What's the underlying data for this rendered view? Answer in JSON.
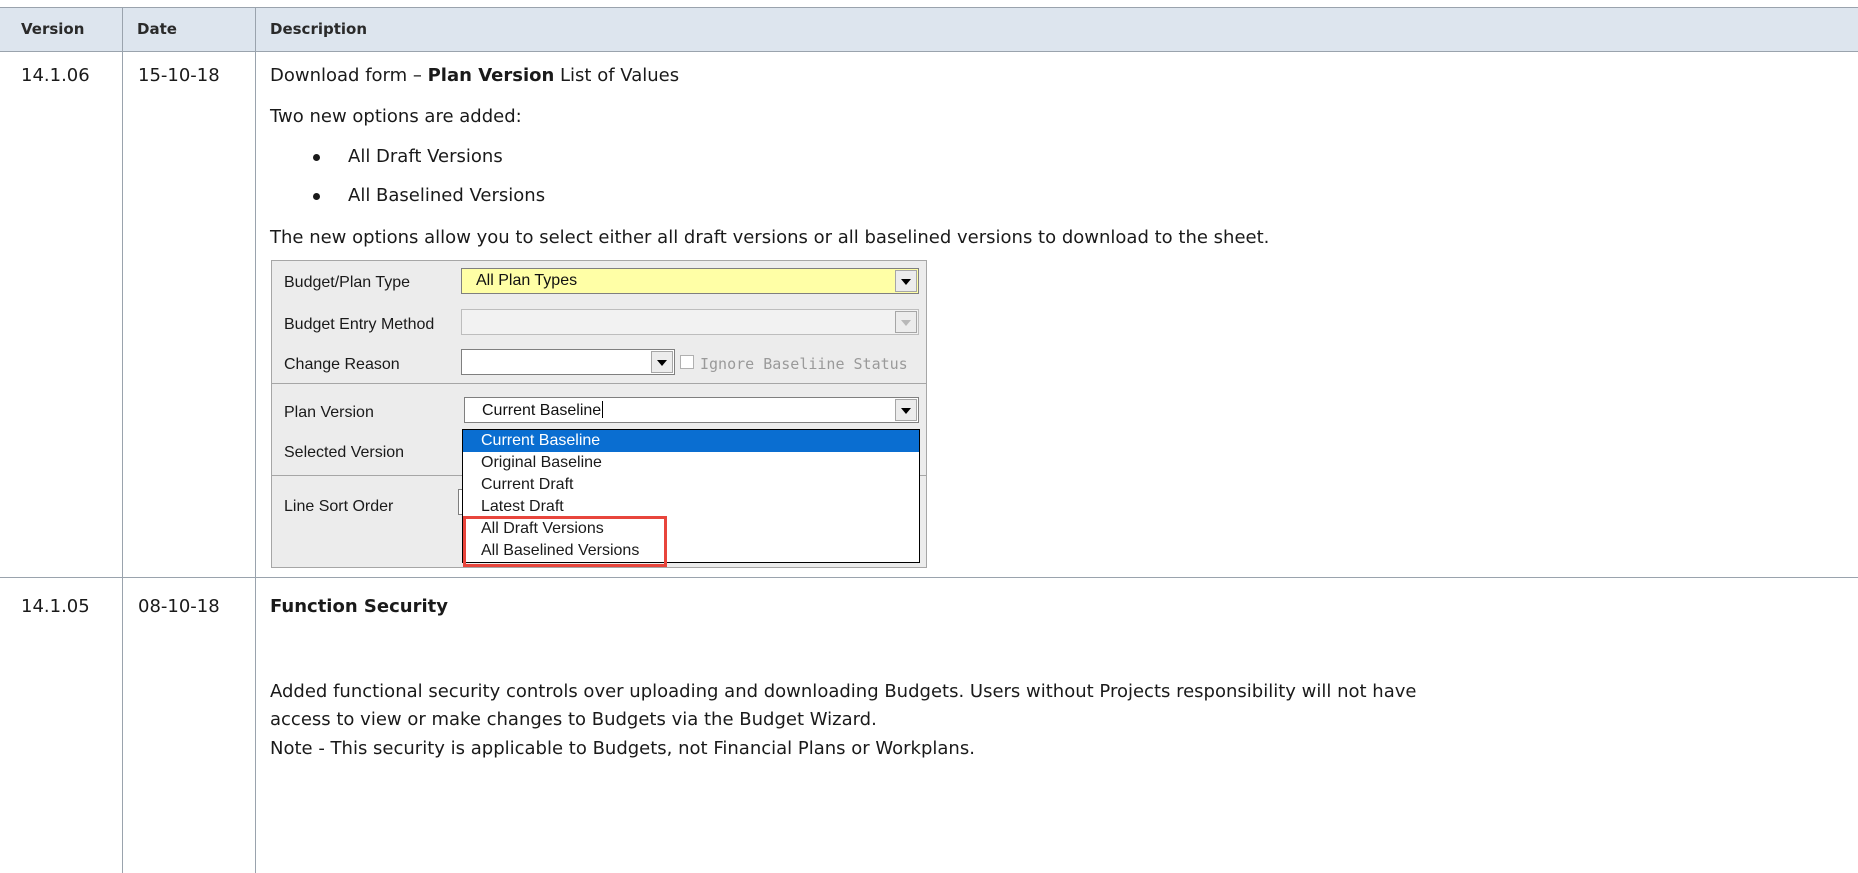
{
  "header": {
    "version": "Version",
    "date": "Date",
    "description": "Description"
  },
  "rows": [
    {
      "version": "14.1.06",
      "date": "15-10-18",
      "line1_prefix": "Download form – ",
      "line1_bold": "Plan Version",
      "line1_suffix": " List of Values",
      "line2": "Two new options are added:",
      "bullets": [
        "All Draft Versions",
        "All Baselined Versions"
      ],
      "line3": "The new options allow you to select either all draft versions or all baselined versions to download to the sheet."
    },
    {
      "version": "14.1.05",
      "date": "08-10-18",
      "title": "Function Security",
      "para1_line1": "Added functional security controls over uploading and downloading Budgets. Users without Projects responsibility will not have",
      "para1_line2": "access to view or make changes to Budgets via the Budget Wizard.",
      "note": "Note - This security is applicable to Budgets, not Financial Plans or Workplans."
    }
  ],
  "form": {
    "budget_plan_type_label": "Budget/Plan Type",
    "budget_plan_type_value": "All Plan Types",
    "budget_entry_method_label": "Budget Entry Method",
    "change_reason_label": "Change Reason",
    "ignore_baseline_label": "Ignore Baseliine Status",
    "plan_version_label": "Plan Version",
    "plan_version_value": "Current Baseline",
    "selected_version_label": "Selected Version",
    "line_sort_order_label": "Line Sort Order",
    "options": [
      "Current Baseline",
      "Original Baseline",
      "Current Draft",
      "Latest Draft",
      "All Draft Versions",
      "All Baselined Versions"
    ]
  },
  "colors": {
    "header_bg": "#dde5ee",
    "highlight_border": "#e8453c",
    "selected_option_bg": "#0a6ed1",
    "required_field_bg": "#ffffa6"
  }
}
